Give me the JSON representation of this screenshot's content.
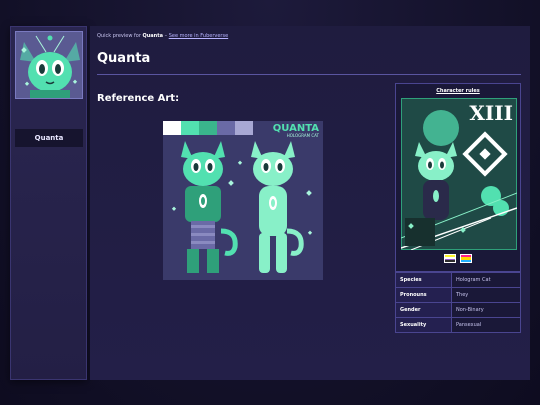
{
  "breadcrumb": {
    "prefix": "Quick preview for",
    "character": "Quanta",
    "separator": "–",
    "link": "See more in Fuberverse"
  },
  "sidebar": {
    "avatar_icon": "character-avatar",
    "name": "Quanta"
  },
  "main": {
    "title": "Quanta",
    "reference_heading": "Reference Art:",
    "reference_logo_line1": "QUANTA",
    "reference_logo_line2": "HOLOGRAM CAT",
    "palette": [
      "#ffffff",
      "#52e0b0",
      "#3ab58c",
      "#6a6aa6",
      "#a8a8d4"
    ]
  },
  "info": {
    "rules_link": "Character rules",
    "card_numeral": "XIII",
    "flags": [
      {
        "name": "nonbinary-flag",
        "colors": [
          "#fff430",
          "#ffffff",
          "#9c59d1",
          "#2c2c2c"
        ]
      },
      {
        "name": "pansexual-flag",
        "colors": [
          "#ff218c",
          "#ffd800",
          "#21b1ff"
        ]
      }
    ],
    "stats": [
      {
        "key": "Species",
        "value": "Hologram Cat"
      },
      {
        "key": "Pronouns",
        "value": "They"
      },
      {
        "key": "Gender",
        "value": "Non-Binary"
      },
      {
        "key": "Sexuality",
        "value": "Pansexual"
      }
    ]
  },
  "colors": {
    "accent": "#52e0b0",
    "panel": "#231f48",
    "border": "#4a4590"
  }
}
